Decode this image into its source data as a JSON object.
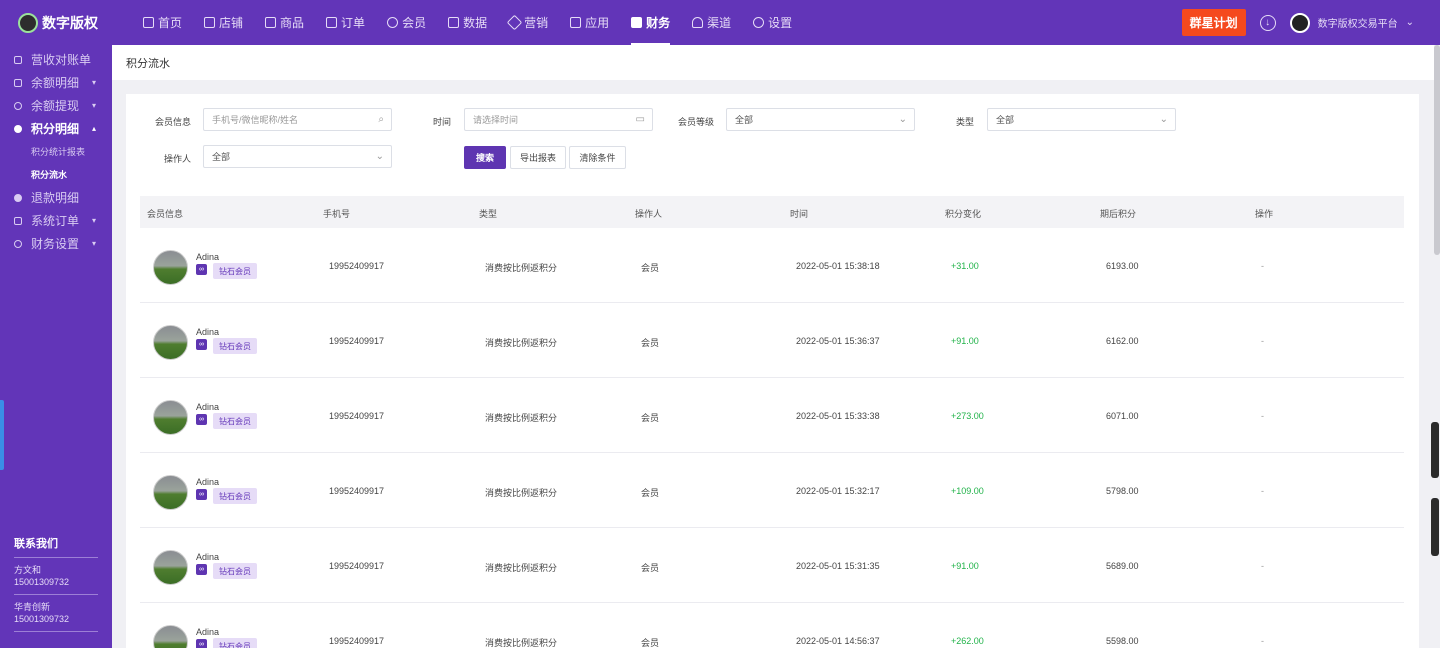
{
  "app": {
    "logo_text": "数字版权"
  },
  "topnav": [
    {
      "label": "首页",
      "icon": "home-icon"
    },
    {
      "label": "店铺",
      "icon": "store-icon"
    },
    {
      "label": "商品",
      "icon": "goods-icon"
    },
    {
      "label": "订单",
      "icon": "order-icon"
    },
    {
      "label": "会员",
      "icon": "member-icon"
    },
    {
      "label": "数据",
      "icon": "data-icon"
    },
    {
      "label": "营销",
      "icon": "tag-icon"
    },
    {
      "label": "应用",
      "icon": "app-icon"
    },
    {
      "label": "财务",
      "icon": "finance-icon",
      "active": true
    },
    {
      "label": "渠道",
      "icon": "channel-icon"
    },
    {
      "label": "设置",
      "icon": "gear-icon"
    }
  ],
  "topbar": {
    "promo_label": "群星计划",
    "user_name": "数字版权交易平台"
  },
  "sidebar": {
    "items": [
      {
        "label": "营收对账单"
      },
      {
        "label": "余额明细",
        "caret": "▾"
      },
      {
        "label": "余额提现",
        "caret": "▾"
      },
      {
        "label": "积分明细",
        "caret": "▴",
        "open": true
      },
      {
        "label": "退款明细"
      },
      {
        "label": "系统订单",
        "caret": "▾"
      },
      {
        "label": "财务设置",
        "caret": "▾"
      }
    ],
    "subitems": [
      {
        "label": "积分统计报表"
      },
      {
        "label": "积分流水",
        "active": true
      }
    ],
    "contact": {
      "title": "联系我们",
      "entries": [
        {
          "name": "方文和",
          "phone": "15001309732"
        },
        {
          "name": "华青创新",
          "phone": "15001309732"
        }
      ]
    }
  },
  "page": {
    "title": "积分流水"
  },
  "filters": {
    "member_label": "会员信息",
    "member_placeholder": "手机号/微信昵称/姓名",
    "time_label": "时间",
    "time_placeholder": "请选择时间",
    "level_label": "会员等级",
    "level_value": "全部",
    "type_label": "类型",
    "type_value": "全部",
    "operator_label": "操作人",
    "operator_value": "全部",
    "search_btn": "搜索",
    "export_btn": "导出报表",
    "clear_btn": "清除条件"
  },
  "table": {
    "headers": [
      "会员信息",
      "手机号",
      "类型",
      "操作人",
      "时间",
      "积分变化",
      "期后积分",
      "操作"
    ],
    "rows": [
      {
        "name": "Adina",
        "level": "钻石会员",
        "phone": "19952409917",
        "type": "消费按比例返积分",
        "operator": "会员",
        "time": "2022-05-01 15:38:18",
        "change": "+31.00",
        "balance": "6193.00",
        "action": "-"
      },
      {
        "name": "Adina",
        "level": "钻石会员",
        "phone": "19952409917",
        "type": "消费按比例返积分",
        "operator": "会员",
        "time": "2022-05-01 15:36:37",
        "change": "+91.00",
        "balance": "6162.00",
        "action": "-"
      },
      {
        "name": "Adina",
        "level": "钻石会员",
        "phone": "19952409917",
        "type": "消费按比例返积分",
        "operator": "会员",
        "time": "2022-05-01 15:33:38",
        "change": "+273.00",
        "balance": "6071.00",
        "action": "-"
      },
      {
        "name": "Adina",
        "level": "钻石会员",
        "phone": "19952409917",
        "type": "消费按比例返积分",
        "operator": "会员",
        "time": "2022-05-01 15:32:17",
        "change": "+109.00",
        "balance": "5798.00",
        "action": "-"
      },
      {
        "name": "Adina",
        "level": "钻石会员",
        "phone": "19952409917",
        "type": "消费按比例返积分",
        "operator": "会员",
        "time": "2022-05-01 15:31:35",
        "change": "+91.00",
        "balance": "5689.00",
        "action": "-"
      },
      {
        "name": "Adina",
        "level": "钻石会员",
        "phone": "19952409917",
        "type": "消费按比例返积分",
        "operator": "会员",
        "time": "2022-05-01 14:56:37",
        "change": "+262.00",
        "balance": "5598.00",
        "action": "-"
      }
    ]
  },
  "colors": {
    "brand": "#6235b8",
    "promo": "#f5491e",
    "positive": "#22b34a"
  }
}
